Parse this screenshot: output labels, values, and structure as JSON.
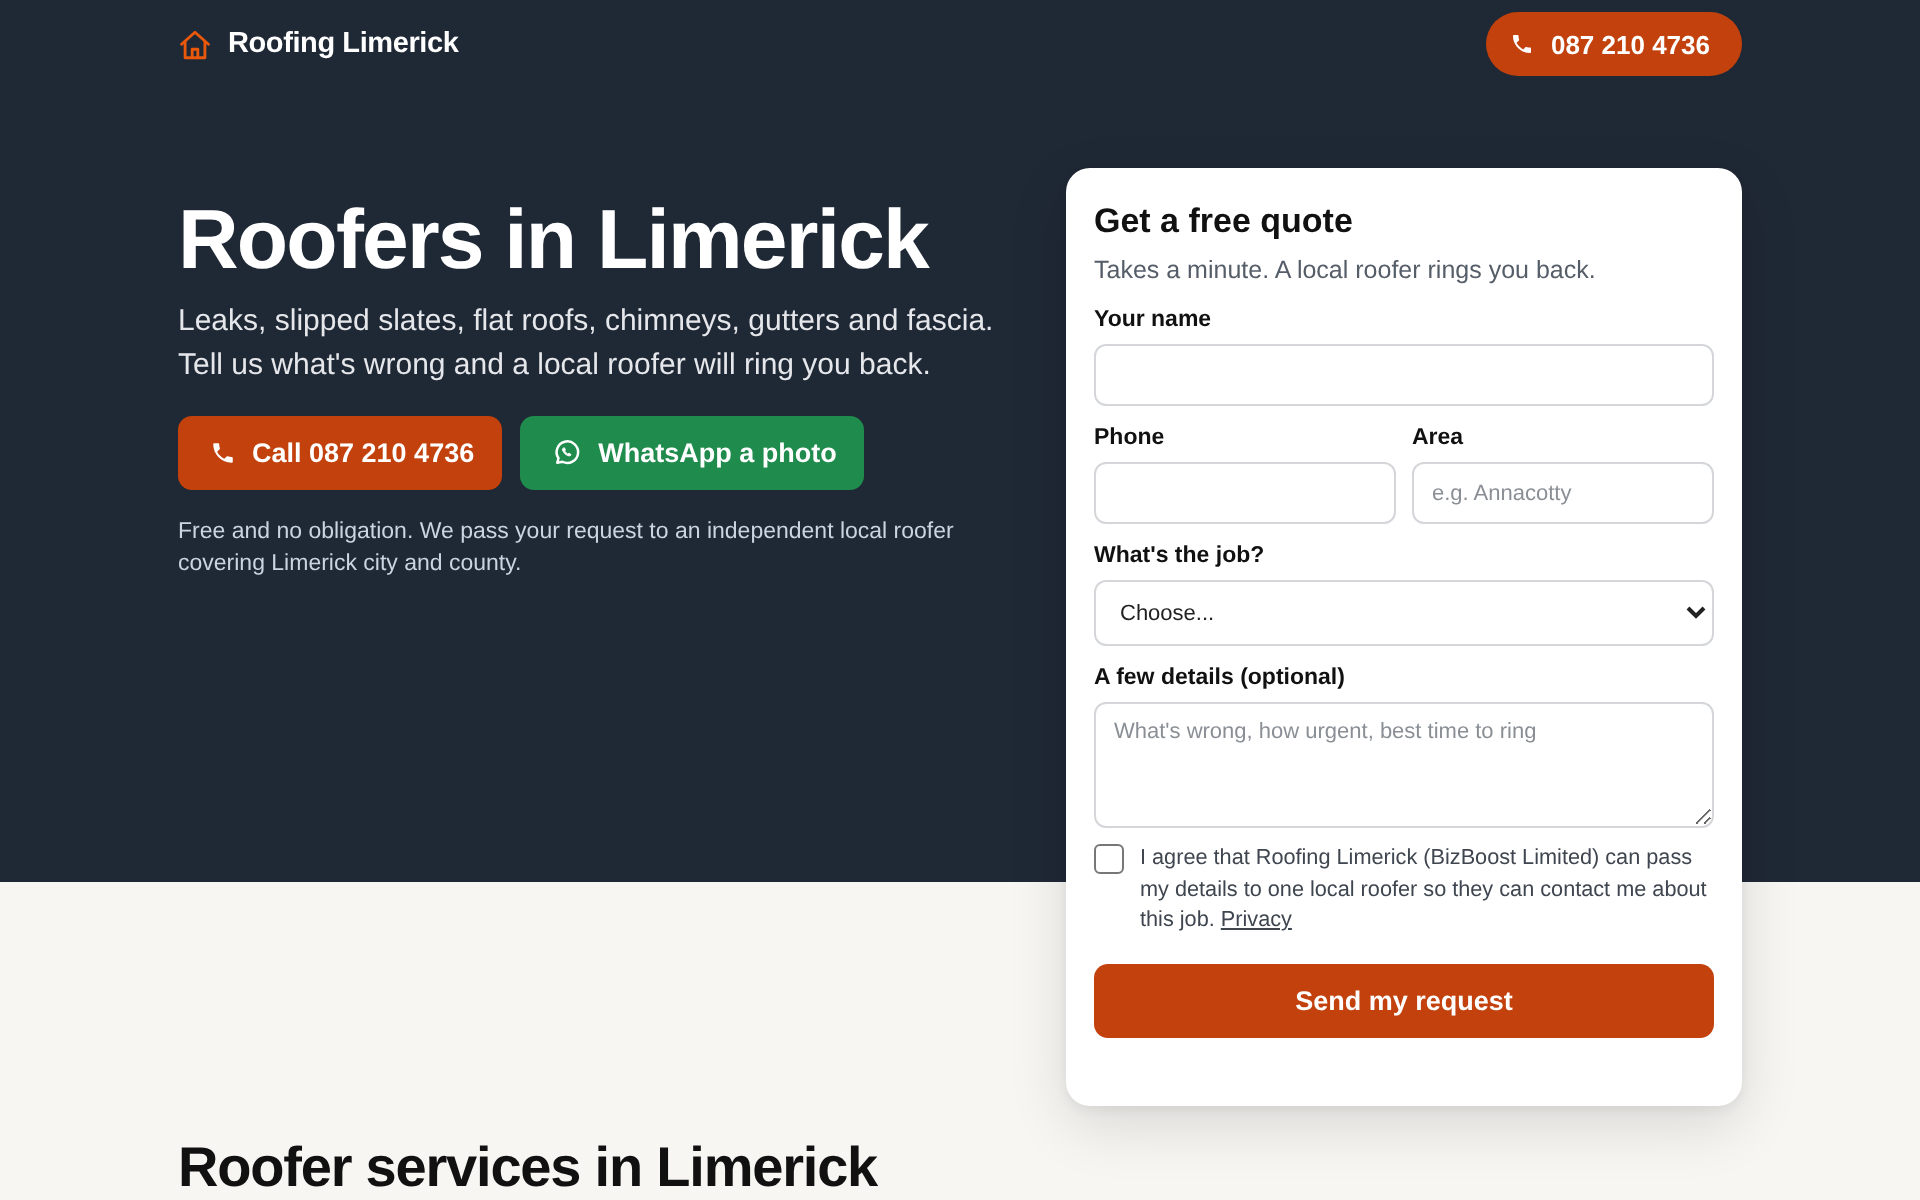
{
  "header": {
    "brand": "Roofing Limerick",
    "phone_button": "087 210 4736"
  },
  "hero": {
    "title": "Roofers in Limerick",
    "subtitle": "Leaks, slipped slates, flat roofs, chimneys, gutters and fascia. Tell us what's wrong and a local roofer will ring you back.",
    "buttons": [
      {
        "kind": "call",
        "label": "Call 087 210 4736"
      },
      {
        "kind": "whatsapp",
        "label": "WhatsApp a photo"
      }
    ],
    "note": "Free and no obligation. We pass your request to an independent local roofer covering Limerick city and county."
  },
  "quote_form": {
    "title": "Get a free quote",
    "subtitle": "Takes a minute. A local roofer rings you back.",
    "rows": [
      [
        {
          "kind": "text",
          "label": "Your name"
        }
      ],
      [
        {
          "kind": "text",
          "label": "Phone"
        },
        {
          "kind": "text",
          "label": "Area",
          "placeholder": "e.g. Annacotty"
        }
      ],
      [
        {
          "kind": "select",
          "label": "What's the job?",
          "value": "Choose..."
        }
      ],
      [
        {
          "kind": "textarea",
          "label": "A few details (optional)",
          "placeholder": "What's wrong, how urgent, best time to ring"
        }
      ]
    ],
    "consent": {
      "checked": false,
      "text": "I agree that Roofing Limerick (BizBoost Limited) can pass my details to one local roofer so they can contact me about this job.",
      "link": "Privacy"
    },
    "submit": "Send my request"
  },
  "services": {
    "title": "Roofer services in Limerick"
  }
}
